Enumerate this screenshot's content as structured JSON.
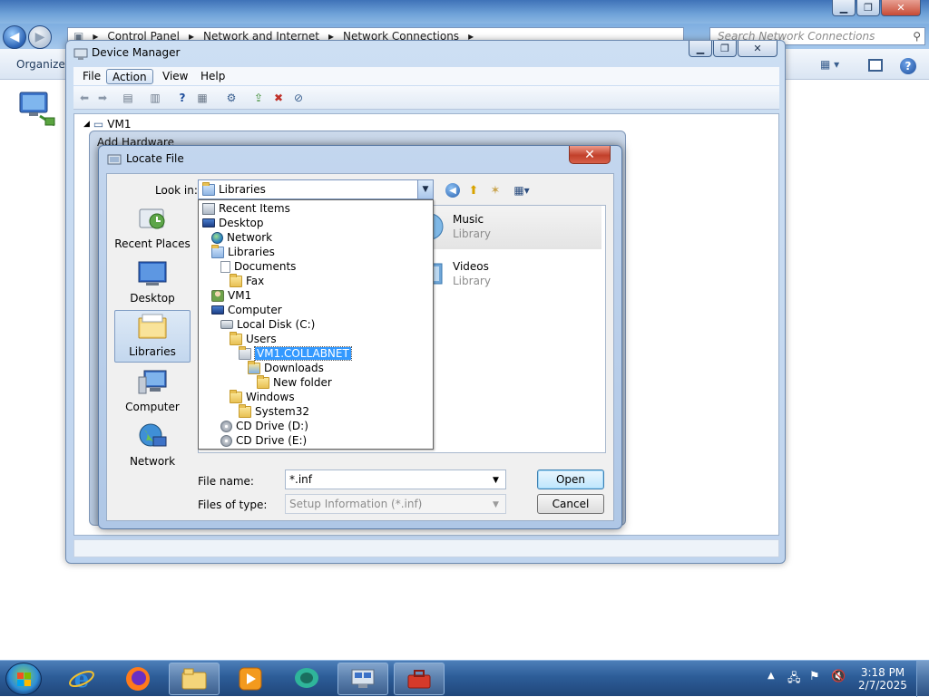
{
  "explorer": {
    "breadcrumb": [
      "Control Panel",
      "Network and Internet",
      "Network Connections"
    ],
    "search_placeholder": "Search Network Connections",
    "toolbar": {
      "organize_label": "Organize"
    }
  },
  "device_manager": {
    "title": "Device Manager",
    "menu": [
      "File",
      "Action",
      "View",
      "Help"
    ],
    "tree_root": "VM1"
  },
  "add_hardware": {
    "title": "Add Hardware"
  },
  "locate_file": {
    "title": "Locate File",
    "look_in_label": "Look in:",
    "look_in_value": "Libraries",
    "places": [
      {
        "label": "Recent Places",
        "icon": "recent-places-icon"
      },
      {
        "label": "Desktop",
        "icon": "desktop-icon"
      },
      {
        "label": "Libraries",
        "icon": "libraries-icon",
        "selected": true
      },
      {
        "label": "Computer",
        "icon": "computer-icon"
      },
      {
        "label": "Network",
        "icon": "network-icon"
      }
    ],
    "files": [
      {
        "name": "Music",
        "type": "Library"
      },
      {
        "name": "Videos",
        "type": "Library"
      }
    ],
    "dropdown": [
      {
        "label": "Recent Items",
        "icon": "recent-items-icon",
        "level": 0
      },
      {
        "label": "Desktop",
        "icon": "desktop-icon",
        "level": 0
      },
      {
        "label": "Network",
        "icon": "network-icon",
        "level": 1
      },
      {
        "label": "Libraries",
        "icon": "libraries-icon",
        "level": 1
      },
      {
        "label": "Documents",
        "icon": "documents-icon",
        "level": 2
      },
      {
        "label": "Fax",
        "icon": "folder-icon",
        "level": 3
      },
      {
        "label": "VM1",
        "icon": "user-folder-icon",
        "level": 1
      },
      {
        "label": "Computer",
        "icon": "computer-icon",
        "level": 1
      },
      {
        "label": "Local Disk (C:)",
        "icon": "drive-icon",
        "level": 2
      },
      {
        "label": "Users",
        "icon": "folder-icon",
        "level": 3
      },
      {
        "label": "VM1.COLLABNET",
        "icon": "folder-icon",
        "level": 4,
        "selected": true
      },
      {
        "label": "Downloads",
        "icon": "downloads-folder-icon",
        "level": 5
      },
      {
        "label": "New folder",
        "icon": "folder-icon",
        "level": 6
      },
      {
        "label": "Windows",
        "icon": "folder-icon",
        "level": 3
      },
      {
        "label": "System32",
        "icon": "folder-icon",
        "level": 4
      },
      {
        "label": "CD Drive (D:)",
        "icon": "cd-drive-icon",
        "level": 2
      },
      {
        "label": "CD Drive (E:)",
        "icon": "cd-drive-icon",
        "level": 2
      }
    ],
    "file_name_label": "File name:",
    "file_name_value": "*.inf",
    "files_of_type_label": "Files of type:",
    "files_of_type_value": "Setup Information (*.inf)",
    "open_label": "Open",
    "cancel_label": "Cancel"
  },
  "taskbar": {
    "clock_time": "3:18 PM",
    "clock_date": "2/7/2025",
    "apps": [
      "internet-explorer-icon",
      "firefox-icon",
      "windows-explorer-icon",
      "media-player-icon",
      "chat-icon",
      "device-manager-icon",
      "toolbox-icon"
    ]
  },
  "colors": {
    "selection": "#3399ff",
    "titlebar": "#c3d6ee",
    "taskbar": "#2d5d98",
    "close_button": "#c2402b"
  }
}
